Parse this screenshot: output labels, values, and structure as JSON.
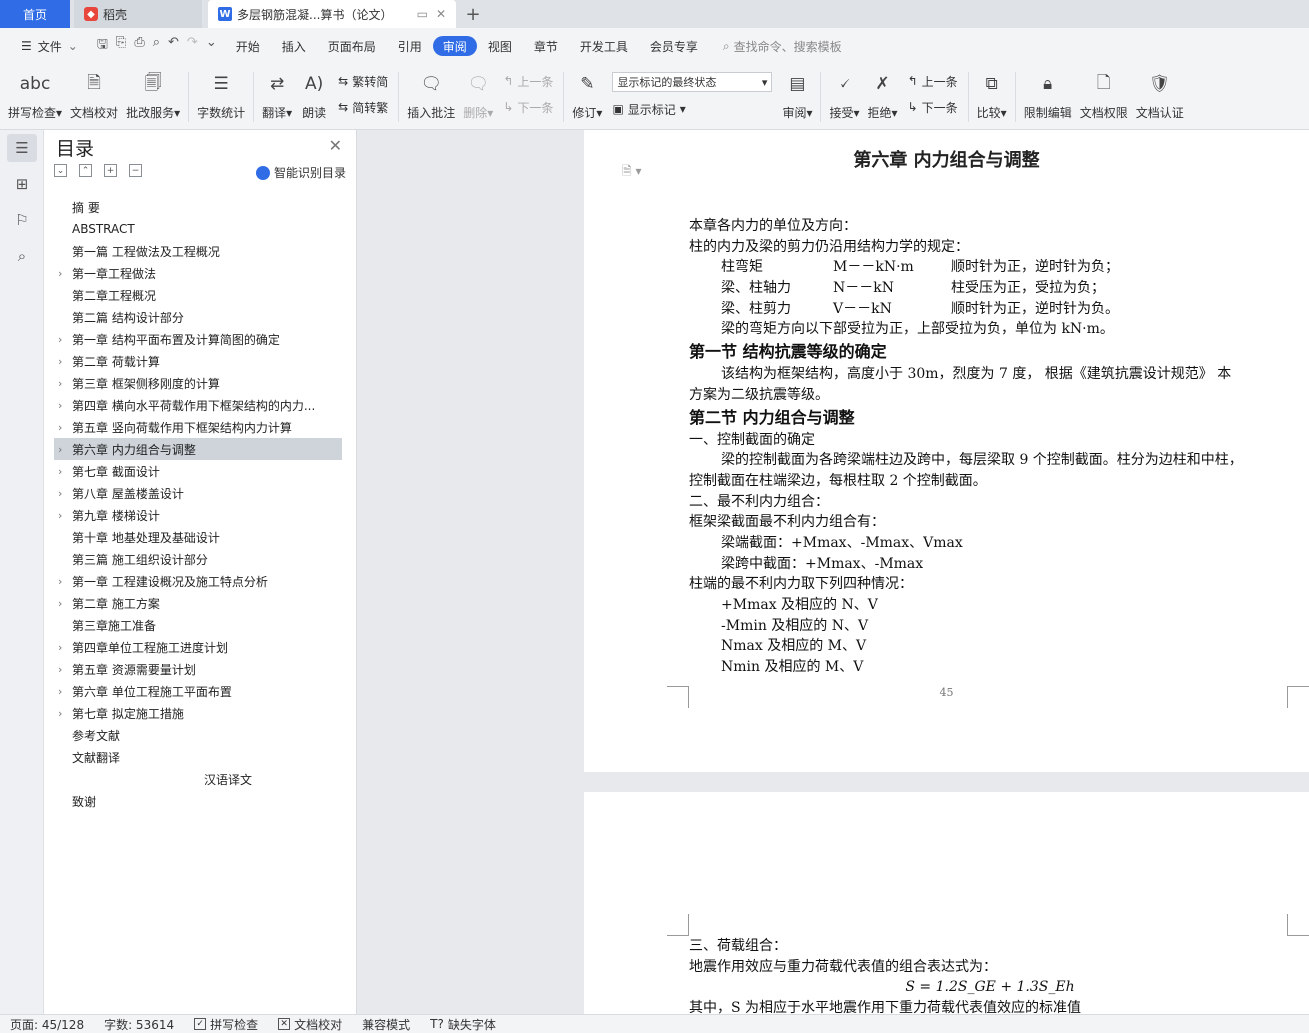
{
  "tabs": {
    "home": "首页",
    "daoke": "稻壳",
    "doc": "多层钢筋混凝...算书（论文）",
    "add": "+"
  },
  "menu": {
    "file": "文件",
    "items": [
      "开始",
      "插入",
      "页面布局",
      "引用",
      "审阅",
      "视图",
      "章节",
      "开发工具",
      "会员专享"
    ],
    "search_hint": "查找命令、搜索模板"
  },
  "ribbon": {
    "spell": "拼写检查",
    "doc_check": "文档校对",
    "batch": "批改服务",
    "word_count": "字数统计",
    "translate": "翻译",
    "read": "朗读",
    "to_trad": "简转繁",
    "to_simp": "繁转简",
    "insert_comment": "插入批注",
    "delete": "删除",
    "prev_comment": "上一条",
    "next_comment": "下一条",
    "revise": "修订",
    "markup_select": "显示标记的最终状态",
    "show_markup": "显示标记",
    "review": "审阅",
    "accept": "接受",
    "reject": "拒绝",
    "prev": "上一条",
    "next": "下一条",
    "compare": "比较",
    "restrict": "限制编辑",
    "permission": "文档权限",
    "certify": "文档认证"
  },
  "toc": {
    "title": "目录",
    "smart": "智能识别目录",
    "items": [
      {
        "label": "摘  要",
        "chev": false
      },
      {
        "label": "ABSTRACT",
        "chev": false
      },
      {
        "label": "第一篇    工程做法及工程概况",
        "chev": false
      },
      {
        "label": "第一章工程做法",
        "chev": true
      },
      {
        "label": "第二章工程概况",
        "chev": false
      },
      {
        "label": "第二篇    结构设计部分",
        "chev": false
      },
      {
        "label": "第一章    结构平面布置及计算简图的确定",
        "chev": true
      },
      {
        "label": "第二章    荷载计算",
        "chev": true
      },
      {
        "label": "第三章    框架侧移刚度的计算",
        "chev": true
      },
      {
        "label": "第四章    横向水平荷载作用下框架结构的内力...",
        "chev": true
      },
      {
        "label": "第五章    竖向荷载作用下框架结构内力计算",
        "chev": true
      },
      {
        "label": "第六章    内力组合与调整",
        "chev": true,
        "selected": true
      },
      {
        "label": "第七章    截面设计",
        "chev": true
      },
      {
        "label": "第八章    屋盖楼盖设计",
        "chev": true
      },
      {
        "label": "第九章  楼梯设计",
        "chev": true
      },
      {
        "label": "第十章  地基处理及基础设计",
        "chev": false
      },
      {
        "label": "第三篇    施工组织设计部分",
        "chev": false
      },
      {
        "label": "第一章    工程建设概况及施工特点分析",
        "chev": true
      },
      {
        "label": "第二章    施工方案",
        "chev": true
      },
      {
        "label": "第三章施工准备",
        "chev": false
      },
      {
        "label": "第四章单位工程施工进度计划",
        "chev": true
      },
      {
        "label": "第五章    资源需要量计划",
        "chev": true
      },
      {
        "label": "第六章    单位工程施工平面布置",
        "chev": true
      },
      {
        "label": "第七章    拟定施工措施",
        "chev": true
      },
      {
        "label": "参考文献",
        "chev": false
      },
      {
        "label": "文献翻译",
        "chev": false
      },
      {
        "label": "汉语译文",
        "chev": false,
        "center": true
      },
      {
        "label": "致谢",
        "chev": false
      }
    ]
  },
  "doc": {
    "chapter_title": "第六章    内力组合与调整",
    "l1": "本章各内力的单位及方向：",
    "l2": "柱的内力及梁的剪力仍沿用结构力学的规定：",
    "r1a": "柱弯矩",
    "r1b": "M－－kN·m",
    "r1c": "顺时针为正，逆时针为负；",
    "r2a": "梁、柱轴力",
    "r2b": "N－－kN",
    "r2c": "柱受压为正，受拉为负；",
    "r3a": "梁、柱剪力",
    "r3b": "V－－kN",
    "r3c": "顺时针为正，逆时针为负。",
    "l6": "梁的弯矩方向以下部受拉为正，上部受拉为负，单位为 kN·m。",
    "h1": "第一节    结构抗震等级的确定",
    "p1a": "该结构为框架结构，高度小于 30m，烈度为 7 度，  根据《建筑抗震设计规范》 本",
    "p1b": "方案为二级抗震等级。",
    "h2": "第二节    内力组合与调整",
    "s1": "一、控制截面的确定",
    "p2a": "梁的控制截面为各跨梁端柱边及跨中，每层梁取 9 个控制截面。柱分为边柱和中柱，",
    "p2b": "控制截面在柱端梁边，每根柱取 2 个控制截面。",
    "s2": "二、最不利内力组合：",
    "l7": "框架梁截面最不利内力组合有：",
    "l8": "梁端截面：+Mmax、-Mmax、Vmax",
    "l9": "梁跨中截面：+Mmax、-Mmax",
    "l10": "柱端的最不利内力取下列四种情况：",
    "c1": "+Mmax 及相应的 N、V",
    "c2": "-Mmin 及相应的 N、V",
    "c3": "Nmax 及相应的 M、V",
    "c4": "Nmin 及相应的 M、V",
    "page_number": "45",
    "s3": "三、荷载组合：",
    "l11": "地震作用效应与重力荷载代表值的组合表达式为：",
    "formula": "S = 1.2S_GE + 1.3S_Eh",
    "l12": "其中，S  为相应于水平地震作用下重力荷载代表值效应的标准值"
  },
  "status": {
    "page": "页面: 45/128",
    "words": "字数: 53614",
    "spell": "拼写检查",
    "doc_check": "文档校对",
    "compat": "兼容模式",
    "missing_font": "缺失字体"
  }
}
